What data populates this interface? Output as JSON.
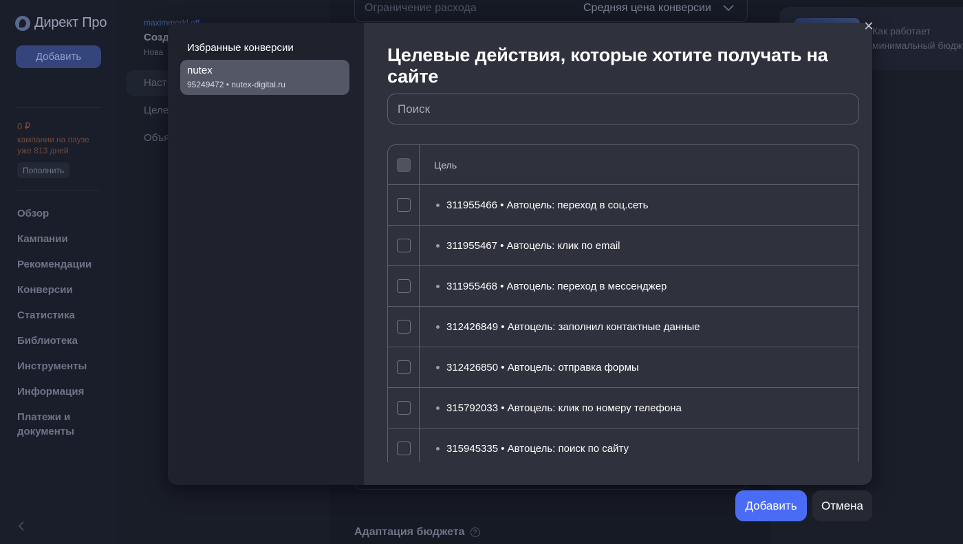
{
  "app": {
    "logo": "Директ Про",
    "add_button": "Добавить",
    "balance": "0 ₽",
    "pause_note": "кампании на паузе уже 813 дней",
    "topup_button": "Пополнить",
    "nav": [
      "Обзор",
      "Кампании",
      "Рекомендации",
      "Конверсии",
      "Статистика",
      "Библиотека",
      "Инструменты",
      "Информация",
      "Платежи и документы"
    ]
  },
  "background": {
    "user_email": "maximmerkl.eff",
    "page_title": "Созд",
    "page_subtitle": "Нова",
    "tabs": [
      "Наст",
      "Целе",
      "Объя"
    ],
    "spend_limit_label": "Ограничение расхода",
    "spend_limit_value": "Средняя цена конверсии",
    "budget_adapt": "Адаптация бюджета",
    "help_icon_glyph": "?",
    "info_card_text": [
      "Как работает",
      "минимальный бюдж"
    ]
  },
  "modal": {
    "left_title": "Избранные конверсии",
    "favorites": [
      {
        "name": "nutex",
        "meta": "95249472 • nutex-digital.ru"
      }
    ],
    "title": "Целевые действия, которые хотите получать на сайте",
    "search_placeholder": "Поиск",
    "table_header": "Цель",
    "goals": [
      "311955466 • Автоцель: переход в соц.сеть",
      "311955467 • Автоцель: клик по email",
      "311955468 • Автоцель: переход в мессенджер",
      "312426849 • Автоцель: заполнил контактные данные",
      "312426850 • Автоцель: отправка формы",
      "315792033 • Автоцель: клик по номеру телефона",
      "315945335 • Автоцель: поиск по сайту"
    ],
    "close_glyph": "✕"
  },
  "footer": {
    "add_button": "Добавить",
    "cancel_button": "Отмена"
  },
  "colors": {
    "accent": "#4a6cf5",
    "modal_bg": "#2f323c",
    "modal_sidebar_bg": "#1f222c",
    "selected_item_bg": "#545866"
  }
}
